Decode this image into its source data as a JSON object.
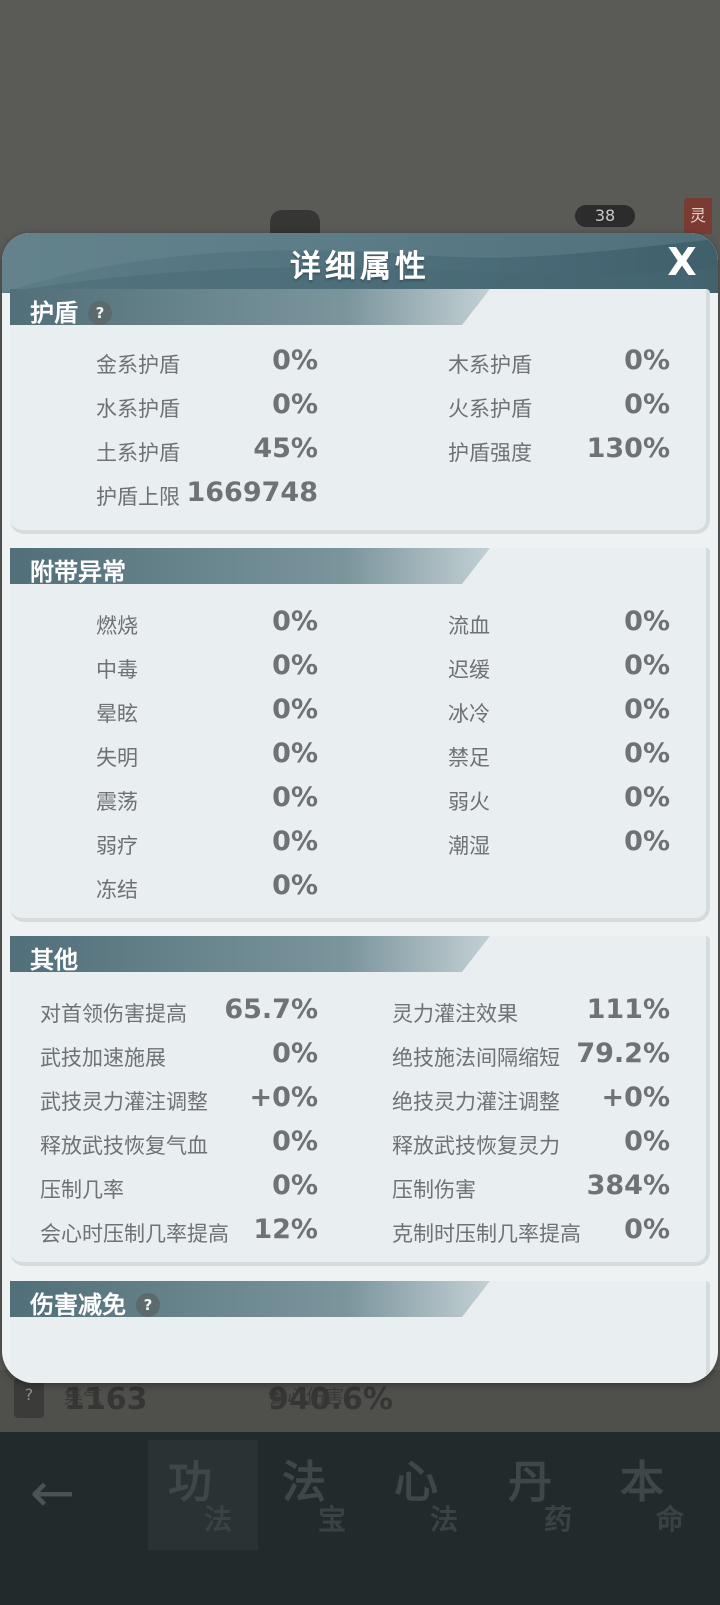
{
  "background": {
    "level_badge": "38",
    "side_tag": "灵"
  },
  "panel": {
    "title": "详细属性",
    "close_glyph": "X"
  },
  "shield": {
    "title": "护盾",
    "help": "?",
    "items": [
      {
        "label": "金系护盾",
        "value": "0%"
      },
      {
        "label": "木系护盾",
        "value": "0%"
      },
      {
        "label": "水系护盾",
        "value": "0%"
      },
      {
        "label": "火系护盾",
        "value": "0%"
      },
      {
        "label": "土系护盾",
        "value": "45%"
      },
      {
        "label": "护盾强度",
        "value": "130%"
      },
      {
        "label": "护盾上限",
        "value": "1669748"
      }
    ]
  },
  "abnormal": {
    "title": "附带异常",
    "items": [
      {
        "label": "燃烧",
        "value": "0%"
      },
      {
        "label": "流血",
        "value": "0%"
      },
      {
        "label": "中毒",
        "value": "0%"
      },
      {
        "label": "迟缓",
        "value": "0%"
      },
      {
        "label": "晕眩",
        "value": "0%"
      },
      {
        "label": "冰冷",
        "value": "0%"
      },
      {
        "label": "失明",
        "value": "0%"
      },
      {
        "label": "禁足",
        "value": "0%"
      },
      {
        "label": "震荡",
        "value": "0%"
      },
      {
        "label": "弱火",
        "value": "0%"
      },
      {
        "label": "弱疗",
        "value": "0%"
      },
      {
        "label": "潮湿",
        "value": "0%"
      },
      {
        "label": "冻结",
        "value": "0%"
      }
    ]
  },
  "other": {
    "title": "其他",
    "items": [
      {
        "label": "对首领伤害提高",
        "value": "65.7%"
      },
      {
        "label": "灵力灌注效果",
        "value": "111%"
      },
      {
        "label": "武技加速施展",
        "value": "0%"
      },
      {
        "label": "绝技施法间隔缩短",
        "value": "79.2%"
      },
      {
        "label": "武技灵力灌注调整",
        "value": "+0%"
      },
      {
        "label": "绝技灵力灌注调整",
        "value": "+0%"
      },
      {
        "label": "释放武技恢复气血",
        "value": "0%"
      },
      {
        "label": "释放武技恢复灵力",
        "value": "0%"
      },
      {
        "label": "压制几率",
        "value": "0%"
      },
      {
        "label": "压制伤害",
        "value": "384%"
      },
      {
        "label": "会心时压制几率提高",
        "value": "12%"
      },
      {
        "label": "克制时压制几率提高",
        "value": "0%"
      }
    ]
  },
  "damage_reduction": {
    "title": "伤害减免",
    "help": "?"
  },
  "stats_strip": {
    "help": "?",
    "qi_label": "集气",
    "qi_value": "1163",
    "crit_label": "会心伤害",
    "crit_value": "940.6%"
  },
  "bottom_nav": {
    "tabs": [
      {
        "big": "功",
        "small": "法"
      },
      {
        "big": "法",
        "small": "宝"
      },
      {
        "big": "心",
        "small": "法"
      },
      {
        "big": "丹",
        "small": "药"
      },
      {
        "big": "本",
        "small": "命"
      }
    ]
  }
}
